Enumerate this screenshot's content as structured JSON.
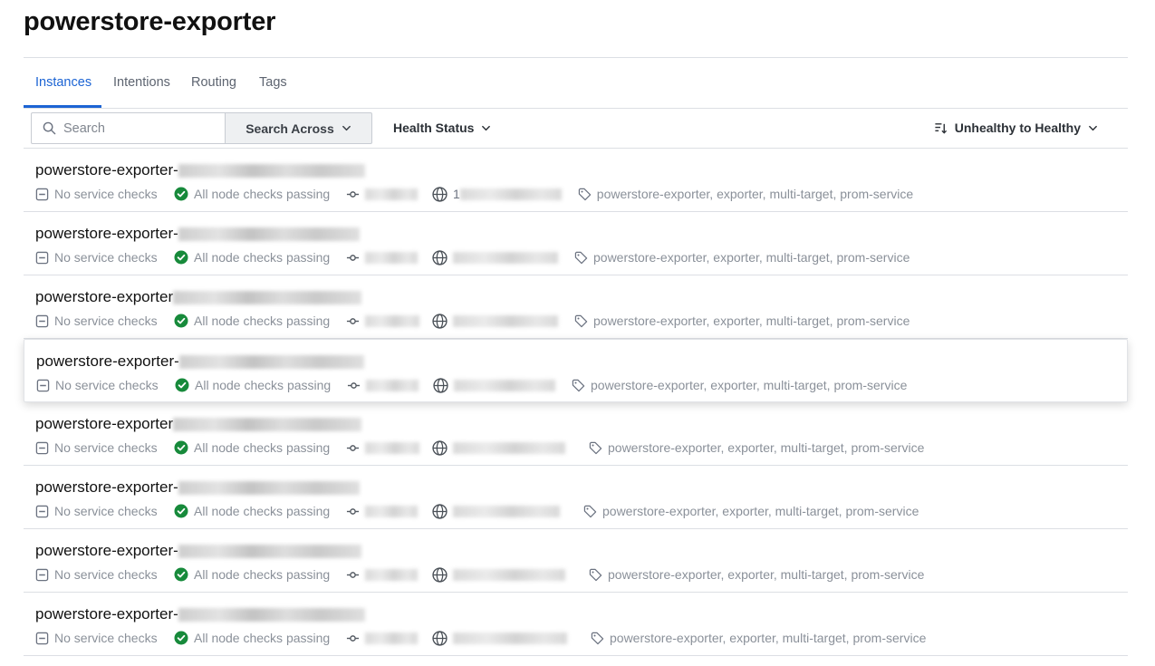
{
  "page": {
    "title": "powerstore-exporter"
  },
  "tabs": [
    {
      "label": "Instances",
      "active": true
    },
    {
      "label": "Intentions",
      "active": false
    },
    {
      "label": "Routing",
      "active": false
    },
    {
      "label": "Tags",
      "active": false
    }
  ],
  "toolbar": {
    "search_placeholder": "Search",
    "search_across_label": "Search Across",
    "health_status_label": "Health Status",
    "sort_label": "Unhealthy to Healthy"
  },
  "instances": [
    {
      "name": "powerstore-exporter-",
      "service_checks": "No service checks",
      "node_checks": "All node checks passing",
      "address_prefix": "1",
      "tags": "powerstore-exporter, exporter, multi-target, prom-service"
    },
    {
      "name": "powerstore-exporter-",
      "service_checks": "No service checks",
      "node_checks": "All node checks passing",
      "address_prefix": "",
      "tags": "powerstore-exporter, exporter, multi-target, prom-service"
    },
    {
      "name": "powerstore-exporter",
      "service_checks": "No service checks",
      "node_checks": "All node checks passing",
      "address_prefix": "",
      "tags": "powerstore-exporter, exporter, multi-target, prom-service"
    },
    {
      "name": "powerstore-exporter-",
      "service_checks": "No service checks",
      "node_checks": "All node checks passing",
      "address_prefix": "",
      "tags": "powerstore-exporter, exporter, multi-target, prom-service"
    },
    {
      "name": "powerstore-exporter",
      "service_checks": "No service checks",
      "node_checks": "All node checks passing",
      "address_prefix": "",
      "tags": "powerstore-exporter, exporter, multi-target, prom-service"
    },
    {
      "name": "powerstore-exporter-",
      "service_checks": "No service checks",
      "node_checks": "All node checks passing",
      "address_prefix": "",
      "tags": "powerstore-exporter, exporter, multi-target, prom-service"
    },
    {
      "name": "powerstore-exporter-",
      "service_checks": "No service checks",
      "node_checks": "All node checks passing",
      "address_prefix": "",
      "tags": "powerstore-exporter, exporter, multi-target, prom-service"
    },
    {
      "name": "powerstore-exporter-",
      "service_checks": "No service checks",
      "node_checks": "All node checks passing",
      "address_prefix": "",
      "tags": "powerstore-exporter, exporter, multi-target, prom-service"
    }
  ],
  "colors": {
    "accent": "#1c64d4",
    "passing": "#178a3b",
    "muted": "#8a9099"
  },
  "icons": {
    "service_checks": "minus-square-icon",
    "node_checks": "check-circle-icon",
    "port": "git-commit-icon",
    "address": "globe-icon",
    "tags": "tag-icon"
  }
}
